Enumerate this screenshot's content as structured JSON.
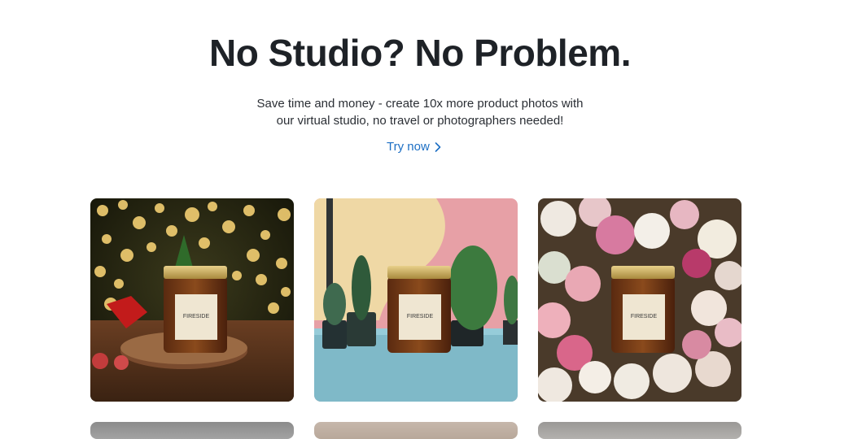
{
  "hero": {
    "title": "No Studio? No Problem.",
    "subtitle_line1": "Save time and money - create 10x more product photos with",
    "subtitle_line2": "our virtual studio, no travel or photographers needed!",
    "cta_label": "Try now",
    "cta_icon": "chevron-right-icon",
    "cta_color": "#1d6fc4"
  },
  "gallery": {
    "items": [
      {
        "scene": "christmas-bokeh",
        "label_text": "FIRESIDE"
      },
      {
        "scene": "cactus-pastel",
        "label_text": "FIRESIDE"
      },
      {
        "scene": "roses",
        "label_text": "FIRESIDE"
      }
    ]
  }
}
